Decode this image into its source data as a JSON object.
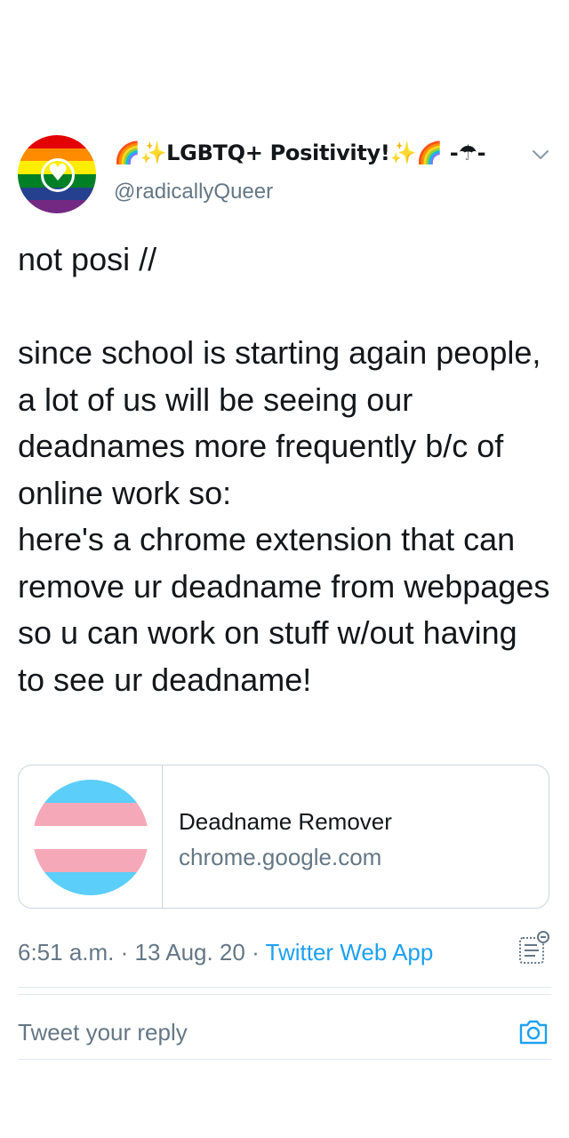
{
  "author": {
    "display_name_prefix": "🌈✨",
    "display_name": "LGBTQ+ Positivity!",
    "display_name_suffix_spark": "✨",
    "display_name_suffix_rainbow": "🌈",
    "display_name_umbrella": "-☂-",
    "handle": "@radicallyQueer",
    "avatar": {
      "colors": [
        "#e40303",
        "#ff8c00",
        "#ffed00",
        "#008026",
        "#24408e",
        "#732982"
      ],
      "center_icon": "heart-icon"
    }
  },
  "tweet": {
    "text": "not posi //\n\nsince school is starting again people, a lot of us will be seeing our deadnames more frequently b/c of online work so:\nhere's a chrome extension that can remove ur deadname from webpages so u can work on stuff w/out having to see ur deadname!"
  },
  "card": {
    "title": "Deadname Remover",
    "domain": "chrome.google.com",
    "thumbnail_colors": [
      "#5bcefa",
      "#f5a9b8",
      "#ffffff",
      "#f5a9b8",
      "#5bcefa"
    ]
  },
  "meta": {
    "time": "6:51 a.m.",
    "separator": " · ",
    "date": "13 Aug. 20",
    "source": "Twitter Web App"
  },
  "reply": {
    "placeholder": "Tweet your reply"
  },
  "icons": {
    "more": "chevron-down-icon",
    "activity": "tweet-activity-icon",
    "camera": "camera-icon"
  },
  "colors": {
    "link": "#1da1f2",
    "secondary_text": "#657786",
    "primary_text": "#14171a",
    "border": "#ccd6dd"
  }
}
